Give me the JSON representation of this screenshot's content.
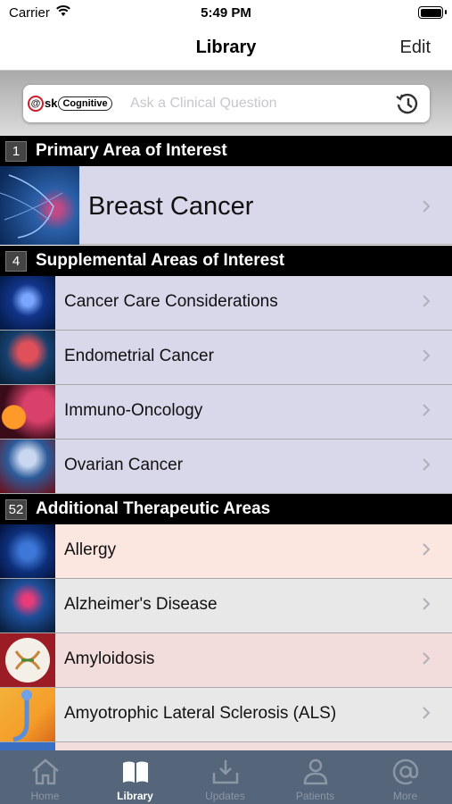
{
  "status": {
    "carrier": "Carrier",
    "time": "5:49 PM"
  },
  "nav": {
    "title": "Library",
    "edit": "Edit"
  },
  "search": {
    "logo_ask": "sk",
    "logo_brand": "Cognitive",
    "placeholder": "Ask a Clinical Question"
  },
  "sections": [
    {
      "count": "1",
      "title": "Primary Area of Interest",
      "items": [
        {
          "label": "Breast Cancer"
        }
      ]
    },
    {
      "count": "4",
      "title": "Supplemental Areas of Interest",
      "items": [
        {
          "label": "Cancer Care Considerations"
        },
        {
          "label": "Endometrial Cancer"
        },
        {
          "label": "Immuno-Oncology"
        },
        {
          "label": "Ovarian Cancer"
        }
      ]
    },
    {
      "count": "52",
      "title": "Additional Therapeutic Areas",
      "items": [
        {
          "label": "Allergy"
        },
        {
          "label": "Alzheimer's Disease"
        },
        {
          "label": "Amyloidosis"
        },
        {
          "label": "Amyotrophic Lateral Sclerosis (ALS)"
        }
      ]
    }
  ],
  "tabs": [
    {
      "label": "Home"
    },
    {
      "label": "Library"
    },
    {
      "label": "Updates"
    },
    {
      "label": "Patients"
    },
    {
      "label": "More"
    }
  ],
  "colors": {
    "supplemental_row": "#d9d8eb",
    "allergy_row": "#fbe6e0",
    "alz_row": "#e8e8e8",
    "amyloid_row": "#f2dcdc",
    "tabbar": "#55657a"
  }
}
